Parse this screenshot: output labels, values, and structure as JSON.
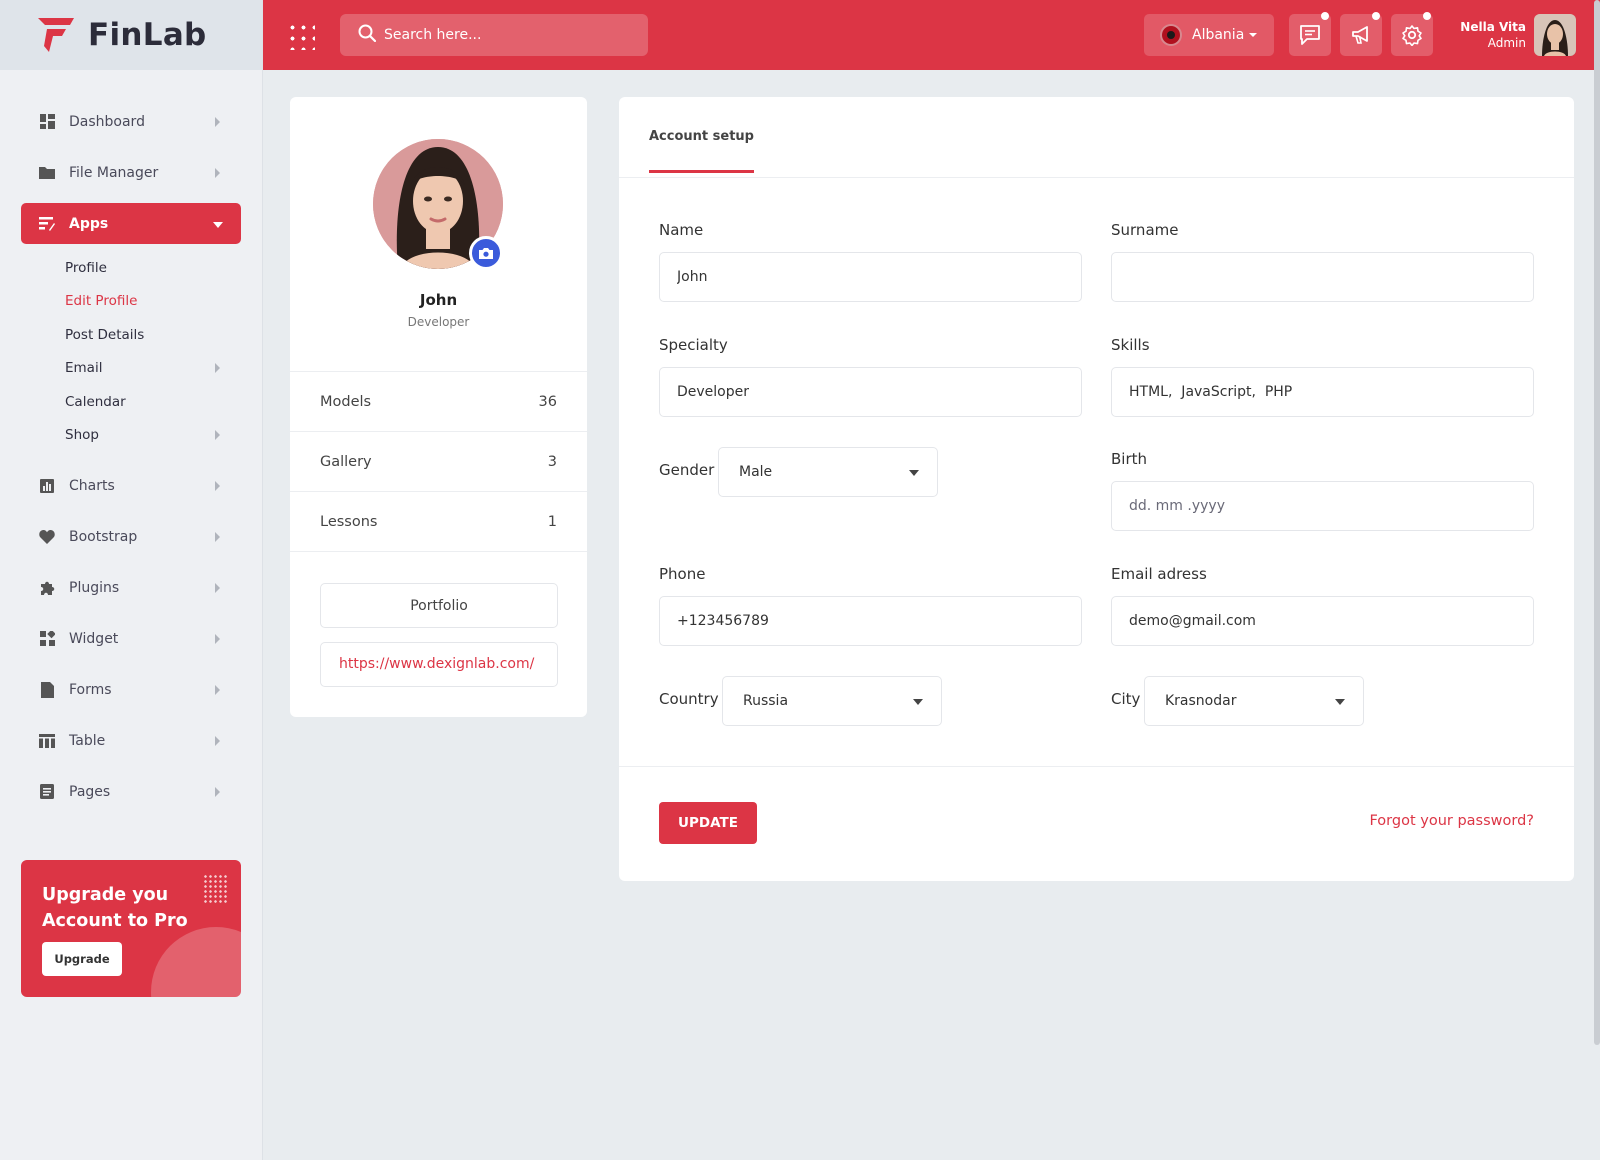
{
  "app": {
    "name": "FinLab"
  },
  "sidebar": {
    "items": [
      {
        "label": "Dashboard",
        "icon": "dashboard-icon"
      },
      {
        "label": "File Manager",
        "icon": "folder-icon"
      },
      {
        "label": "Apps",
        "icon": "apps-icon",
        "active": true
      },
      {
        "label": "Charts",
        "icon": "chart-icon"
      },
      {
        "label": "Bootstrap",
        "icon": "heart-icon"
      },
      {
        "label": "Plugins",
        "icon": "puzzle-icon"
      },
      {
        "label": "Widget",
        "icon": "widget-icon"
      },
      {
        "label": "Forms",
        "icon": "form-icon"
      },
      {
        "label": "Table",
        "icon": "table-icon"
      },
      {
        "label": "Pages",
        "icon": "pages-icon"
      }
    ],
    "apps_sub": [
      {
        "label": "Profile"
      },
      {
        "label": "Edit Profile",
        "current": true
      },
      {
        "label": "Post Details"
      },
      {
        "label": "Email"
      },
      {
        "label": "Calendar"
      },
      {
        "label": "Shop"
      }
    ],
    "upgrade": {
      "title_line1": "Upgrade you",
      "title_line2": "Account to Pro",
      "button": "Upgrade"
    }
  },
  "header": {
    "search_placeholder": "Search here...",
    "language": "Albania",
    "user_name": "Nella Vita",
    "user_role": "Admin"
  },
  "profile": {
    "name": "John",
    "role": "Developer",
    "stats": [
      {
        "label": "Models",
        "value": "36"
      },
      {
        "label": "Gallery",
        "value": "3"
      },
      {
        "label": "Lessons",
        "value": "1"
      }
    ],
    "portfolio_label": "Portfolio",
    "portfolio_url": "https://www.dexignlab.com/"
  },
  "account": {
    "tab": "Account setup",
    "name_label": "Name",
    "name_value": "John",
    "surname_label": "Surname",
    "surname_value": "",
    "specialty_label": "Specialty",
    "specialty_value": "Developer",
    "skills_label": "Skills",
    "skills_value": "HTML,  JavaScript,  PHP",
    "gender_label": "Gender",
    "gender_value": "Male",
    "birth_label": "Birth",
    "birth_placeholder": "dd. mm .yyyy",
    "phone_label": "Phone",
    "phone_value": "+123456789",
    "email_label": "Email adress",
    "email_value": "demo@gmail.com",
    "country_label": "Country",
    "country_value": "Russia",
    "city_label": "City",
    "city_value": "Krasnodar",
    "update_button": "UPDATE",
    "forgot_link": "Forgot your password?"
  },
  "colors": {
    "accent": "#dc3545",
    "camera": "#3b5bdb"
  }
}
